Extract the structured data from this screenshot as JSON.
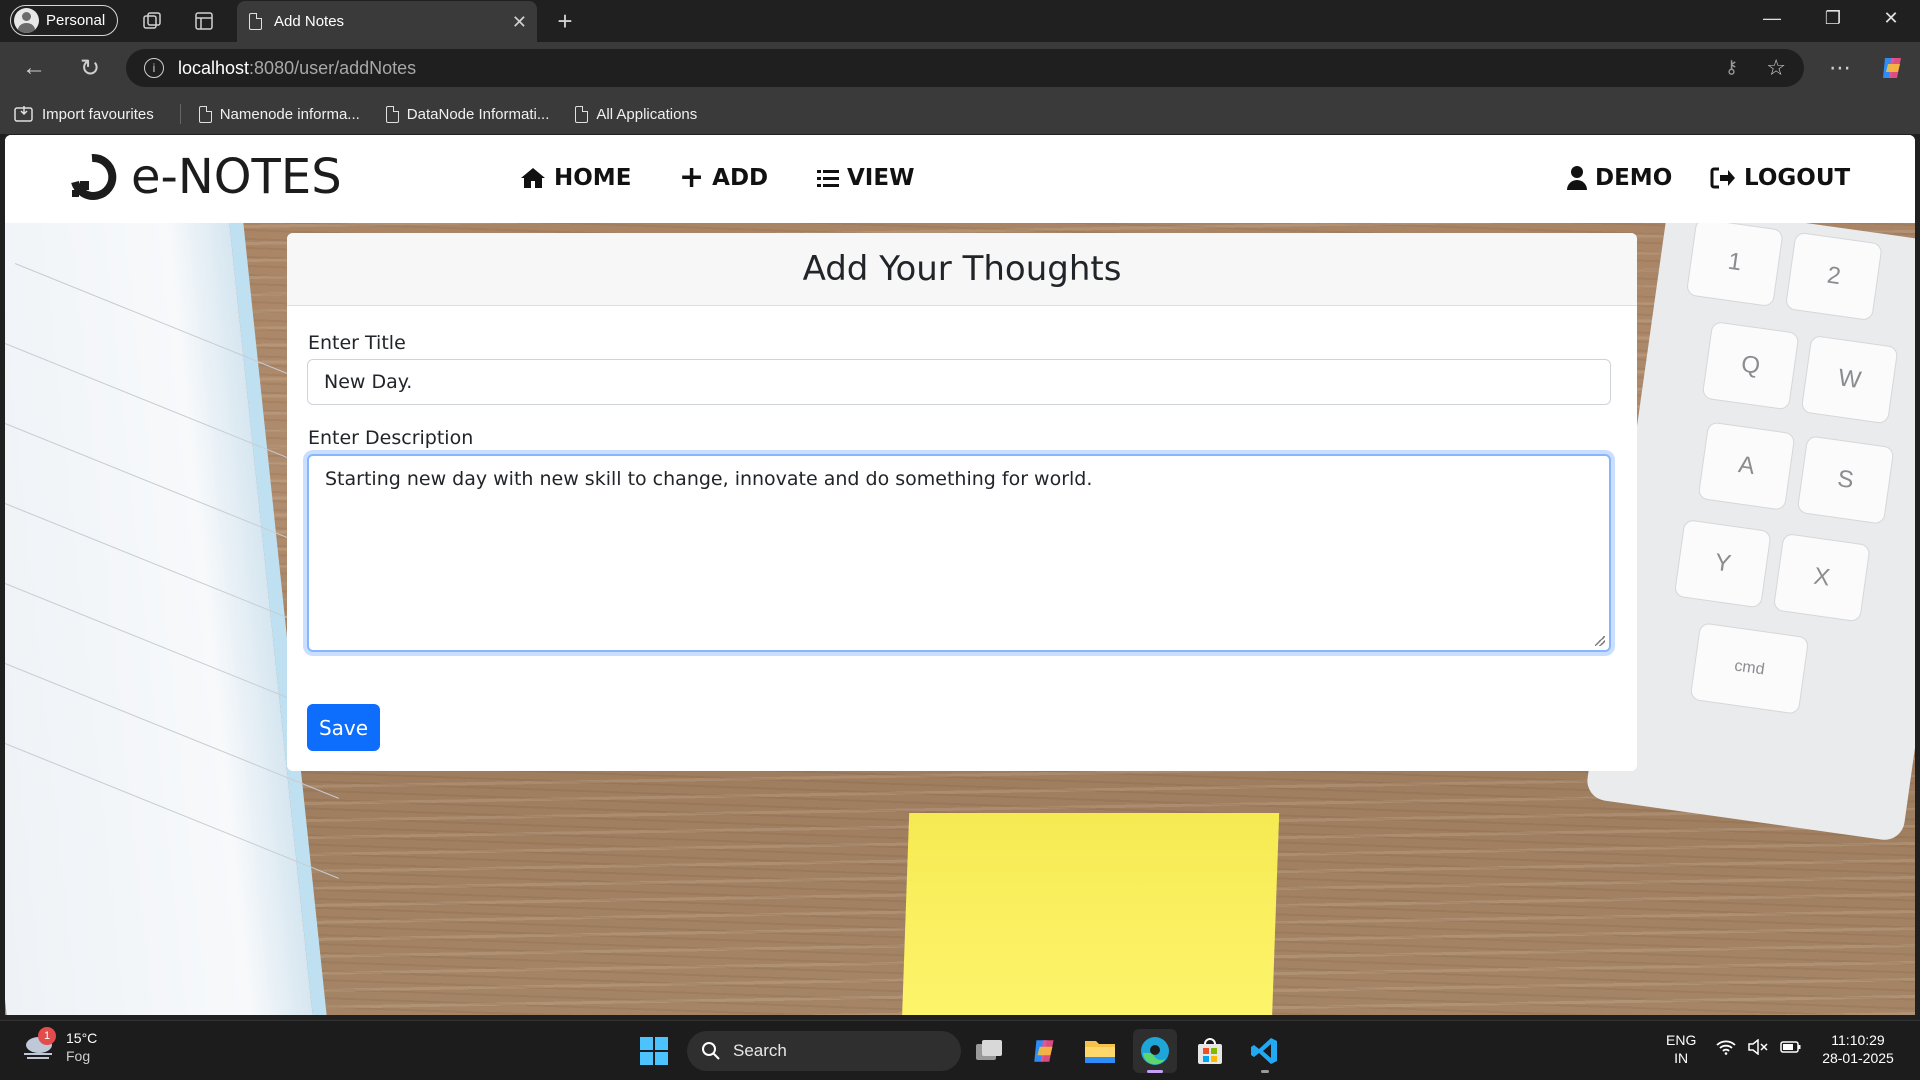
{
  "browser": {
    "profile_label": "Personal",
    "tab_title": "Add Notes",
    "url_host": "localhost",
    "url_path": ":8080/user/addNotes",
    "bookmarks": [
      "Import favourites",
      "Namenode informa...",
      "DataNode Informati...",
      "All Applications"
    ]
  },
  "navbar": {
    "brand": "e-NOTES",
    "home": "HOME",
    "add": "ADD",
    "view": "VIEW",
    "user": "DEMO",
    "logout": "LOGOUT"
  },
  "form": {
    "header": "Add Your Thoughts",
    "title_label": "Enter Title",
    "title_value": "New Day.",
    "description_label": "Enter Description",
    "description_value": "Starting new day with new skill to change, innovate and do something for world.",
    "save_label": "Save"
  },
  "background": {
    "keys": [
      "1",
      "2",
      "Q",
      "W",
      "A",
      "S",
      "Y",
      "X",
      "cmd"
    ]
  },
  "taskbar": {
    "weather_badge": "1",
    "temperature": "15°C",
    "condition": "Fog",
    "search_placeholder": "Search",
    "lang_top": "ENG",
    "lang_bottom": "IN",
    "time": "11:10:29",
    "date": "28-01-2025"
  },
  "colors": {
    "primary": "#0d6efd",
    "focus_ring": "#86b7fe",
    "chrome_dark": "#202020",
    "chrome_mid": "#3a3a3a"
  }
}
